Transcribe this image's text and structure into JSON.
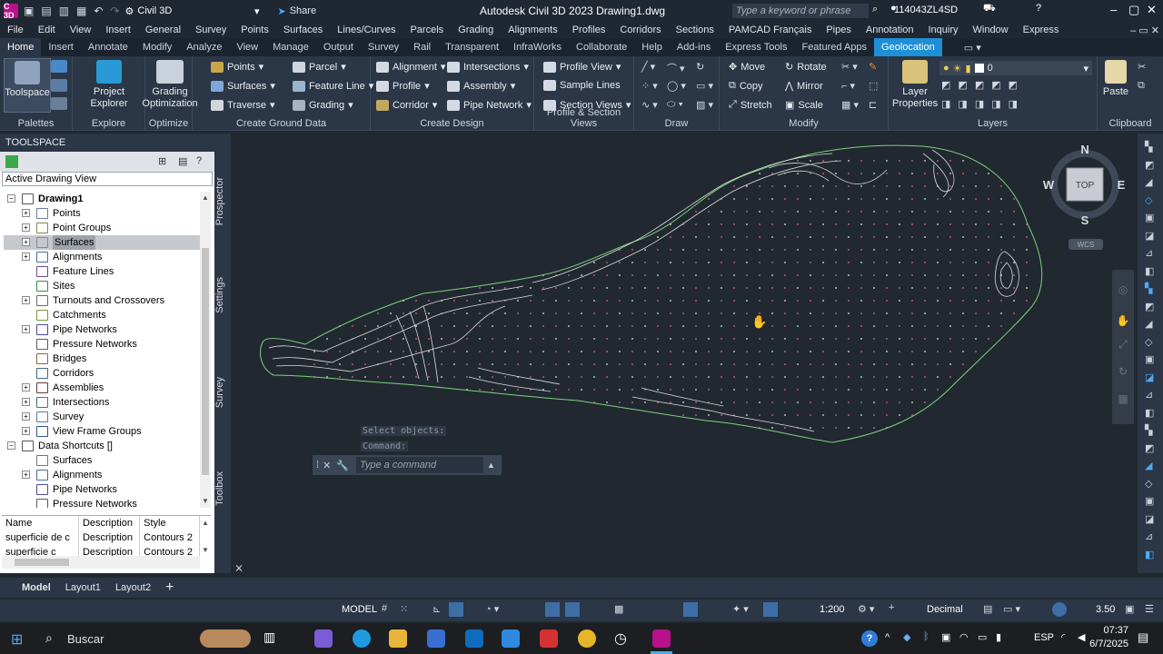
{
  "app": {
    "icon_text": "C 3D",
    "workspace": "Civil 3D",
    "share_label": "Share",
    "doc_title": "Autodesk Civil 3D 2023   Drawing1.dwg",
    "search_placeholder": "Type a keyword or phrase",
    "user": "114043ZL4SD"
  },
  "menu": [
    "File",
    "Edit",
    "View",
    "Insert",
    "General",
    "Survey",
    "Points",
    "Surfaces",
    "Lines/Curves",
    "Parcels",
    "Grading",
    "Alignments",
    "Profiles",
    "Corridors",
    "Sections",
    "PAMCAD Français",
    "Pipes",
    "Annotation",
    "Inquiry",
    "Window",
    "Express"
  ],
  "tabs": [
    "Home",
    "Insert",
    "Annotate",
    "Modify",
    "Analyze",
    "View",
    "Manage",
    "Output",
    "Survey",
    "Rail",
    "Transparent",
    "InfraWorks",
    "Collaborate",
    "Help",
    "Add-ins",
    "Express Tools",
    "Featured Apps",
    "Geolocation"
  ],
  "ribbon": {
    "palettes": {
      "toolspace": "Toolspace",
      "title": "Palettes"
    },
    "explore": {
      "btn": "Project Explorer",
      "title": "Explore"
    },
    "optimize": {
      "btn": "Grading Optimization",
      "title": "Optimize"
    },
    "ground": {
      "points": "Points",
      "surfaces": "Surfaces",
      "traverse": "Traverse",
      "parcel": "Parcel",
      "feature_line": "Feature Line",
      "grading": "Grading",
      "title": "Create Ground Data"
    },
    "design": {
      "alignment": "Alignment",
      "profile": "Profile",
      "corridor": "Corridor",
      "intersections": "Intersections",
      "assembly": "Assembly",
      "pipe_network": "Pipe Network",
      "title": "Create Design"
    },
    "profsec": {
      "profile_view": "Profile View",
      "sample_lines": "Sample Lines",
      "section_views": "Section Views",
      "title": "Profile & Section Views"
    },
    "draw": {
      "title": "Draw"
    },
    "modify": {
      "move": "Move",
      "copy": "Copy",
      "stretch": "Stretch",
      "rotate": "Rotate",
      "mirror": "Mirror",
      "scale": "Scale",
      "title": "Modify"
    },
    "layers": {
      "btn": "Layer Properties",
      "layer_value": "0",
      "title": "Layers"
    },
    "clipboard": {
      "btn": "Paste",
      "title": "Clipboard"
    }
  },
  "toolspace": {
    "title": "TOOLSPACE",
    "view": "Active Drawing View",
    "tree": [
      {
        "label": "Drawing1",
        "level": 0,
        "pm": "−",
        "bold": true
      },
      {
        "label": "Points",
        "level": 1,
        "pm": "+"
      },
      {
        "label": "Point Groups",
        "level": 1,
        "pm": "+"
      },
      {
        "label": "Surfaces",
        "level": 1,
        "pm": "+",
        "selected": true
      },
      {
        "label": "Alignments",
        "level": 1,
        "pm": "+"
      },
      {
        "label": "Feature Lines",
        "level": 1,
        "pm": ""
      },
      {
        "label": "Sites",
        "level": 1,
        "pm": ""
      },
      {
        "label": "Turnouts and Crossovers",
        "level": 1,
        "pm": "+"
      },
      {
        "label": "Catchments",
        "level": 1,
        "pm": ""
      },
      {
        "label": "Pipe Networks",
        "level": 1,
        "pm": "+"
      },
      {
        "label": "Pressure Networks",
        "level": 1,
        "pm": ""
      },
      {
        "label": "Bridges",
        "level": 1,
        "pm": ""
      },
      {
        "label": "Corridors",
        "level": 1,
        "pm": ""
      },
      {
        "label": "Assemblies",
        "level": 1,
        "pm": "+"
      },
      {
        "label": "Intersections",
        "level": 1,
        "pm": "+"
      },
      {
        "label": "Survey",
        "level": 1,
        "pm": "+"
      },
      {
        "label": "View Frame Groups",
        "level": 1,
        "pm": "+"
      },
      {
        "label": "Data Shortcuts []",
        "level": 0,
        "pm": "−"
      },
      {
        "label": "Surfaces",
        "level": 1,
        "pm": ""
      },
      {
        "label": "Alignments",
        "level": 1,
        "pm": "+"
      },
      {
        "label": "Pipe Networks",
        "level": 1,
        "pm": ""
      },
      {
        "label": "Pressure Networks",
        "level": 1,
        "pm": ""
      }
    ],
    "grid_headers": [
      "Name",
      "Description",
      "Style"
    ],
    "grid_rows": [
      [
        "superficie de c",
        "Description",
        "Contours 2"
      ],
      [
        "superficie c",
        "Description",
        "Contours 2"
      ]
    ]
  },
  "side_tabs": [
    "Prospector",
    "Settings",
    "Survey",
    "Toolbox"
  ],
  "viewcube": {
    "n": "N",
    "s": "S",
    "e": "E",
    "w": "W",
    "top": "TOP",
    "wcs": "WCS"
  },
  "command": {
    "history1": "Select objects:",
    "history2": "Command:",
    "placeholder": "Type a command"
  },
  "layouts": [
    "Model",
    "Layout1",
    "Layout2"
  ],
  "status": {
    "model": "MODEL",
    "scale": "1:200",
    "units": "Decimal",
    "value": "3.50"
  },
  "taskbar": {
    "search": "Buscar",
    "lang": "ESP",
    "time": "07:37",
    "date": "6/7/2025"
  }
}
